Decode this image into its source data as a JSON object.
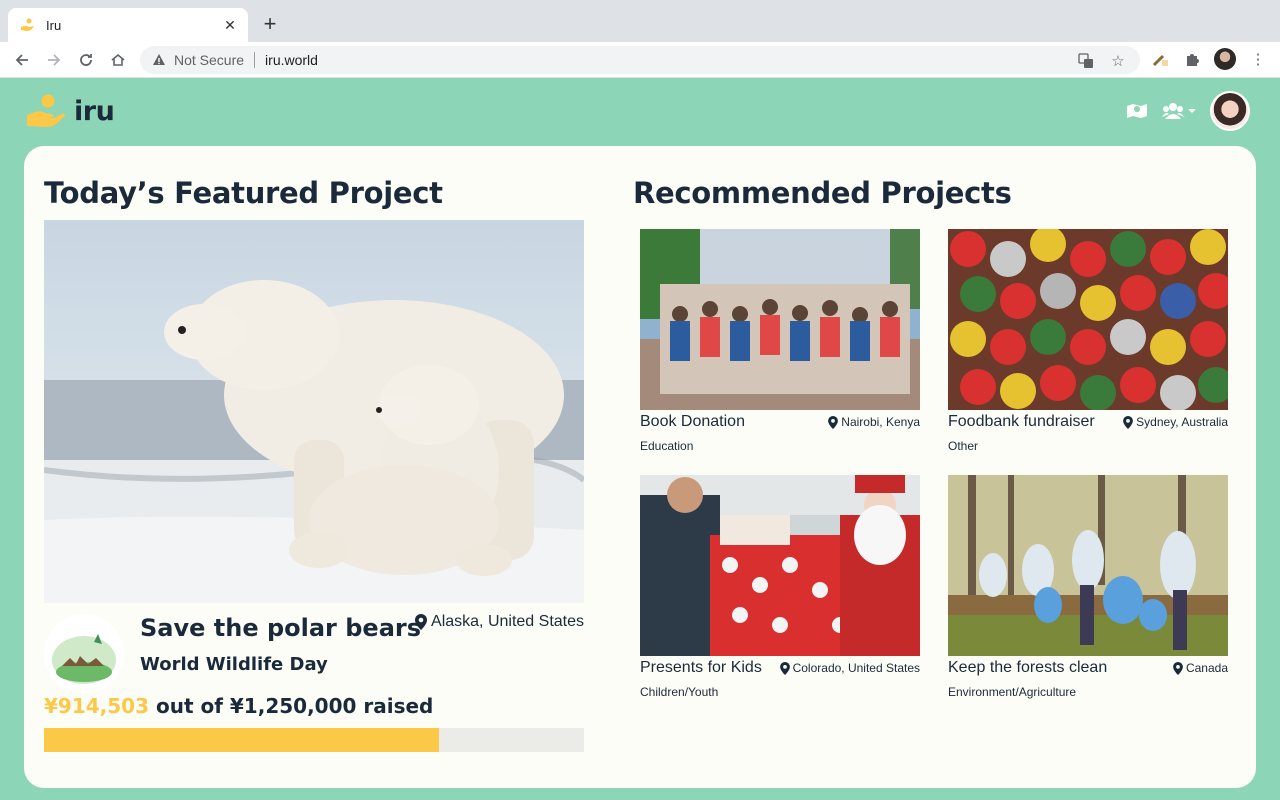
{
  "browser": {
    "tab_title": "Iru",
    "not_secure": "Not Secure",
    "url": "iru.world"
  },
  "app": {
    "logo_text": "iru",
    "accent_color": "#fcc847",
    "background_color": "#8cd5b6",
    "text_color": "#1b2a3a"
  },
  "featured": {
    "section_title": "Today’s Featured Project",
    "project_name": "Save the polar bears",
    "organization": "World Wildlife Day",
    "location": "Alaska, United States",
    "raised_amount": "¥914,503",
    "raised_suffix": "out of ¥1,250,000 raised",
    "progress_fraction": 0.7316
  },
  "recommended": {
    "section_title": "Recommended Projects",
    "projects": [
      {
        "title": "Book Donation",
        "location": "Nairobi, Kenya",
        "category": "Education"
      },
      {
        "title": "Foodbank fundraiser",
        "location": "Sydney, Australia",
        "category": "Other"
      },
      {
        "title": "Presents for Kids",
        "location": "Colorado, United States",
        "category": "Children/Youth"
      },
      {
        "title": "Keep the forests clean",
        "location": "Canada",
        "category": "Environment/Agriculture"
      }
    ]
  }
}
